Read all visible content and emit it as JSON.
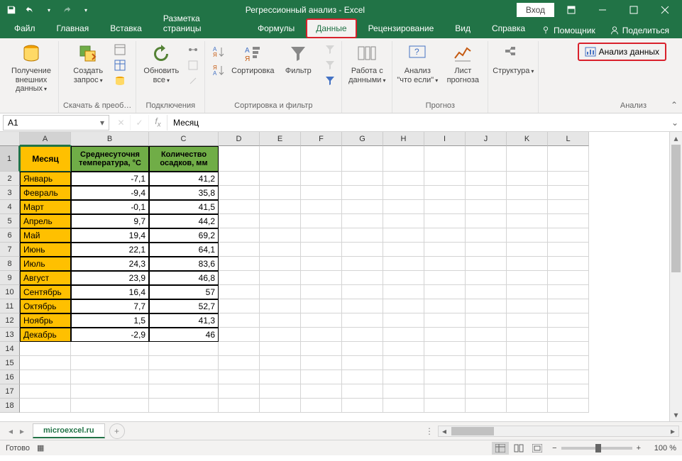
{
  "app": {
    "title": "Регрессионный анализ  -  Excel",
    "signin": "Вход"
  },
  "tabs": {
    "file": "Файл",
    "home": "Главная",
    "insert": "Вставка",
    "layout": "Разметка страницы",
    "formulas": "Формулы",
    "data": "Данные",
    "review": "Рецензирование",
    "view": "Вид",
    "help": "Справка",
    "assist": "Помощник",
    "share": "Поделиться"
  },
  "ribbon": {
    "ext_data": "Получение внешних данных",
    "new_query": "Создать запрос",
    "get_transform": "Скачать & преоб…",
    "refresh_all": "Обновить все",
    "connections": "Подключения",
    "sort": "Сортировка",
    "filter": "Фильтр",
    "sort_filter": "Сортировка и фильтр",
    "data_tools": "Работа с данными",
    "whatif": "Анализ \"что если\"",
    "forecast_sheet": "Лист прогноза",
    "forecast": "Прогноз",
    "outline": "Структура",
    "analysis_btn": "Анализ данных",
    "analysis": "Анализ"
  },
  "fbar": {
    "namebox": "A1",
    "formula": "Месяц"
  },
  "columns": [
    "A",
    "B",
    "C",
    "D",
    "E",
    "F",
    "G",
    "H",
    "I",
    "J",
    "K",
    "L"
  ],
  "col_widths": {
    "A": 72,
    "B": 110,
    "C": 98,
    "other": 58
  },
  "headers": {
    "A": "Месяц",
    "B": "Среднесуточня температура, °C",
    "C": "Количество осадков, мм"
  },
  "rows": [
    {
      "m": "Январь",
      "t": "-7,1",
      "p": "41,2"
    },
    {
      "m": "Февраль",
      "t": "-9,4",
      "p": "35,8"
    },
    {
      "m": "Март",
      "t": "-0,1",
      "p": "41,5"
    },
    {
      "m": "Апрель",
      "t": "9,7",
      "p": "44,2"
    },
    {
      "m": "Май",
      "t": "19,4",
      "p": "69,2"
    },
    {
      "m": "Июнь",
      "t": "22,1",
      "p": "64,1"
    },
    {
      "m": "Июль",
      "t": "24,3",
      "p": "83,6"
    },
    {
      "m": "Август",
      "t": "23,9",
      "p": "46,8"
    },
    {
      "m": "Сентябрь",
      "t": "16,4",
      "p": "57"
    },
    {
      "m": "Октябрь",
      "t": "7,7",
      "p": "52,7"
    },
    {
      "m": "Ноябрь",
      "t": "1,5",
      "p": "41,3"
    },
    {
      "m": "Декабрь",
      "t": "-2,9",
      "p": "46"
    }
  ],
  "sheet": {
    "name": "microexcel.ru"
  },
  "status": {
    "ready": "Готово",
    "zoom": "100 %"
  }
}
